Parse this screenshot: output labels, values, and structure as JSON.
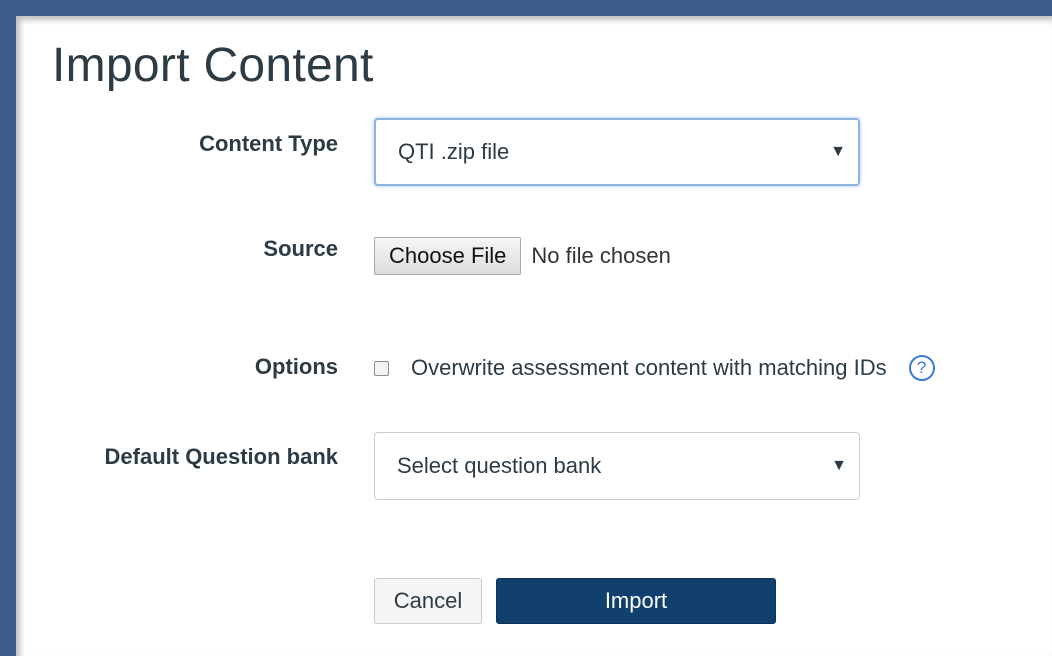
{
  "page": {
    "title": "Import Content"
  },
  "form": {
    "content_type": {
      "label": "Content Type",
      "selected": "QTI .zip file"
    },
    "source": {
      "label": "Source",
      "button_label": "Choose File",
      "status": "No file chosen"
    },
    "options": {
      "label": "Options",
      "checkbox_label": "Overwrite assessment content with matching IDs",
      "checked": false,
      "help_glyph": "?"
    },
    "question_bank": {
      "label": "Default Question bank",
      "selected": "Select question bank"
    },
    "actions": {
      "cancel_label": "Cancel",
      "import_label": "Import"
    }
  },
  "icons": {
    "dropdown": "chevron-down-icon",
    "help": "help-circle-icon"
  },
  "colors": {
    "primary_button": "#11406e",
    "focus_ring": "#8fb4e0",
    "help_accent": "#3a7bd5",
    "frame_border": "#3c5a8a"
  }
}
